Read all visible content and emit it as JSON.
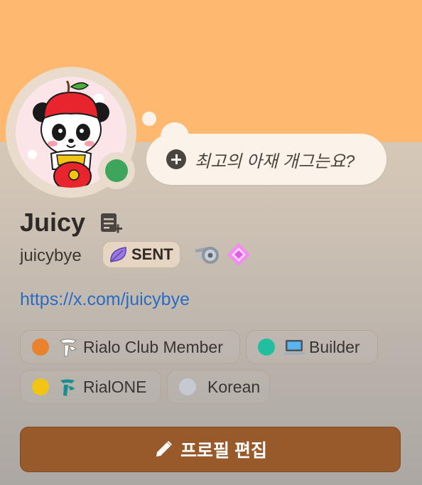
{
  "banner": {
    "color": "#ffb870"
  },
  "avatar": {
    "icon": "panda-apple-avatar",
    "status": "online",
    "status_color": "#3ea55d"
  },
  "status_bubble": {
    "icon": "plus-circle-icon",
    "text": "최고의 아재 개그는요?"
  },
  "profile": {
    "display_name": "Juicy",
    "username": "juicybye",
    "link": "https://x.com/juicybye"
  },
  "server_tag": {
    "icon": "leaf-icon",
    "text": "SENT"
  },
  "badges": [
    {
      "icon": "turbo-speed-badge-icon"
    },
    {
      "icon": "pink-diamond-badge-icon"
    }
  ],
  "roles": [
    {
      "label": "Rialo Club Member",
      "dot_color": "#e8822c",
      "icon": "rialo-logo-icon"
    },
    {
      "label": "Builder",
      "dot_color": "#1fbf9f",
      "icon": "laptop-icon"
    },
    {
      "label": "RialONE",
      "dot_color": "#f2c414",
      "icon": "rialone-logo-icon"
    },
    {
      "label": "Korean",
      "dot_color": "#c4c9d2",
      "icon": ""
    }
  ],
  "edit_button": {
    "icon": "pencil-icon",
    "label": "프로필 편집"
  },
  "colors": {
    "accent_button": "#985a2b",
    "link": "#2a6bc4"
  }
}
